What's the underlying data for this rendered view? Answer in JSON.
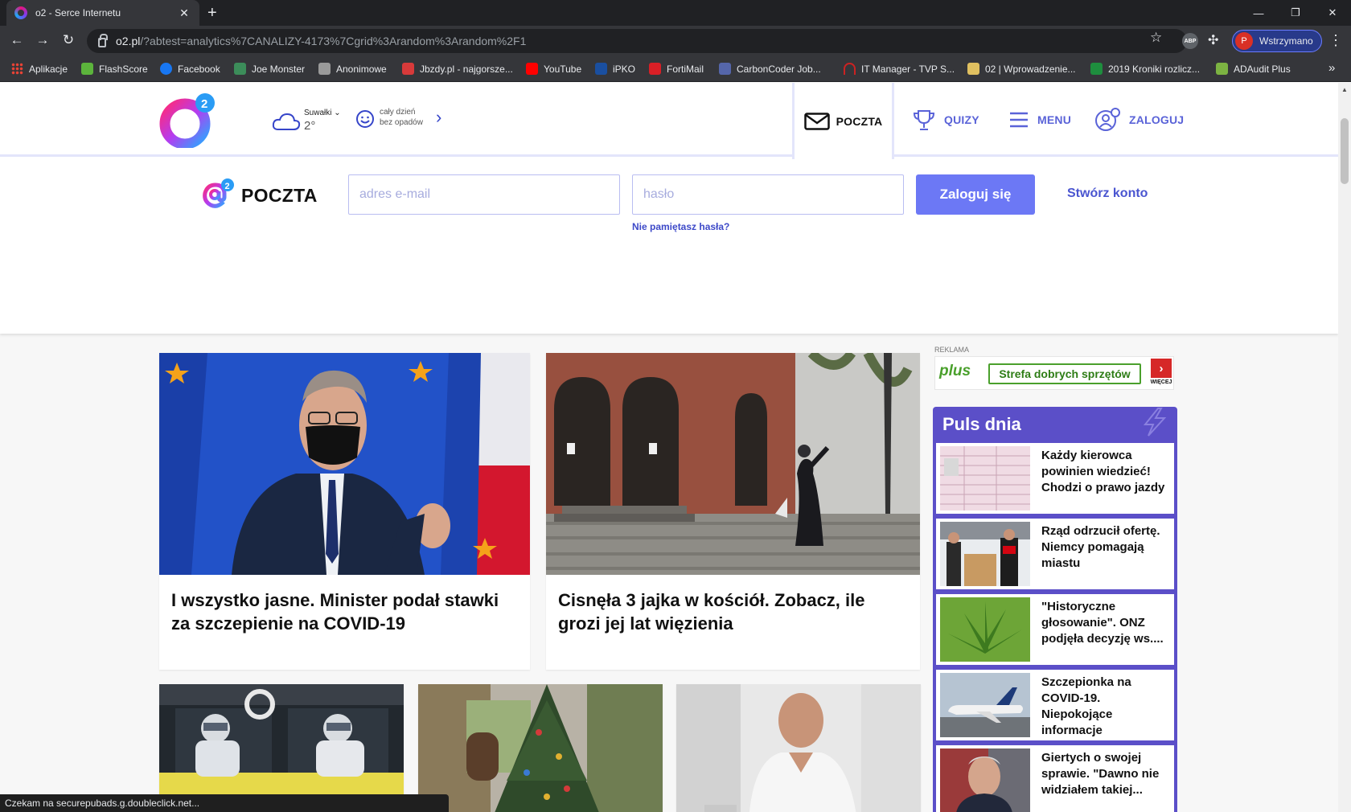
{
  "browser": {
    "tab_title": "o2 - Serce Internetu",
    "url_host": "o2.pl",
    "url_rest": "/?abtest=analytics%7CANALIZY-4173%7Cgrid%3Arandom%3Arandom%2F1",
    "profile_initial": "P",
    "profile_label": "Wstrzymano",
    "ext_label": "ABP",
    "bookmarks": [
      {
        "label": "Aplikacje",
        "icon": "apps-grid-icon",
        "color": "#e8eaed"
      },
      {
        "label": "FlashScore",
        "icon": "flashscore-icon",
        "color": "#5cb43c"
      },
      {
        "label": "Facebook",
        "icon": "facebook-icon",
        "color": "#1877f2"
      },
      {
        "label": "Joe Monster",
        "icon": "joemonster-icon",
        "color": "#3c8d5a"
      },
      {
        "label": "Anonimowe",
        "icon": "anonimowe-icon",
        "color": "#bbbbbb"
      },
      {
        "label": "Jbzdy.pl - najgorsze...",
        "icon": "jbzdy-icon",
        "color": "#d83a3a"
      },
      {
        "label": "YouTube",
        "icon": "youtube-icon",
        "color": "#ff0000"
      },
      {
        "label": "iPKO",
        "icon": "ipko-icon",
        "color": "#1a4fa0"
      },
      {
        "label": "FortiMail",
        "icon": "fortimail-icon",
        "color": "#d91f26"
      },
      {
        "label": "CarbonCoder Job...",
        "icon": "carboncoder-icon",
        "color": "#5566aa"
      },
      {
        "label": "IT Manager - TVP S...",
        "icon": "itmanager-icon",
        "color": "#cc2222"
      },
      {
        "label": "02 | Wprowadzenie...",
        "icon": "folder-doc-icon",
        "color": "#e0c060"
      },
      {
        "label": "2019 Kroniki rozlicz...",
        "icon": "spreadsheet-icon",
        "color": "#1e8e3e"
      },
      {
        "label": "ADAudit Plus",
        "icon": "adaudit-icon",
        "color": "#7cb342"
      }
    ],
    "status_text": "Czekam na securepubads.g.doubleclick.net..."
  },
  "header": {
    "weather": {
      "city": "Suwałki",
      "temp": "2°",
      "forecast_line1": "cały dzień",
      "forecast_line2": "bez opadów"
    },
    "nav": {
      "poczta": "POCZTA",
      "quizy": "QUIZY",
      "menu": "MENU",
      "zaloguj": "ZALOGUJ"
    }
  },
  "mail": {
    "logo_text": "POCZTA",
    "email_placeholder": "adres e-mail",
    "password_placeholder": "hasło",
    "forgot": "Nie pamiętasz hasła?",
    "login_button": "Zaloguj się",
    "create_account": "Stwórz konto"
  },
  "articles": [
    {
      "title": "I wszystko jasne. Minister podał stawki za szczepienie na COVID-19"
    },
    {
      "title": "Cisnęła 3 jajka w kościół. Zobacz, ile grozi jej lat więzienia"
    }
  ],
  "ad": {
    "label": "REKLAMA",
    "brand": "plus",
    "text": "Strefa dobrych sprzętów",
    "more": "WIĘCEJ"
  },
  "puls": {
    "title": "Puls dnia",
    "items": [
      {
        "text": "Każdy kierowca powinien wiedzieć! Chodzi o prawo jazdy"
      },
      {
        "text": "Rząd odrzucił ofertę. Niemcy pomagają miastu"
      },
      {
        "text": "\"Historyczne głosowanie\". ONZ podjęła decyzję ws...."
      },
      {
        "text": "Szczepionka na COVID-19. Niepokojące informacje"
      },
      {
        "text": "Giertych o swojej sprawie. \"Dawno nie widziałem takiej..."
      }
    ]
  },
  "colors": {
    "accent": "#6c78f5",
    "link": "#4a55d0",
    "puls_bg": "#5b4fc8"
  }
}
